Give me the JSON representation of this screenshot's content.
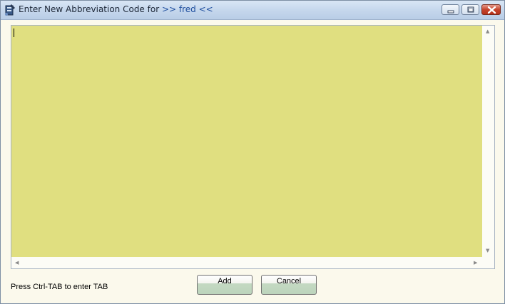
{
  "window": {
    "title_prefix": "Enter New Abbreviation Code for",
    "title_highlight": " >> fred << "
  },
  "editor": {
    "value": "",
    "background": "#e0df80"
  },
  "footer": {
    "hint": "Press Ctrl-TAB to enter TAB",
    "add_label": "Add",
    "cancel_label": "Cancel"
  },
  "icons": {
    "app": "app-icon",
    "minimize": "minimize-icon",
    "maximize": "maximize-icon",
    "close": "close-icon",
    "scroll_up": "arrow-up-icon",
    "scroll_down": "arrow-down-icon",
    "scroll_left": "arrow-left-icon",
    "scroll_right": "arrow-right-icon"
  }
}
